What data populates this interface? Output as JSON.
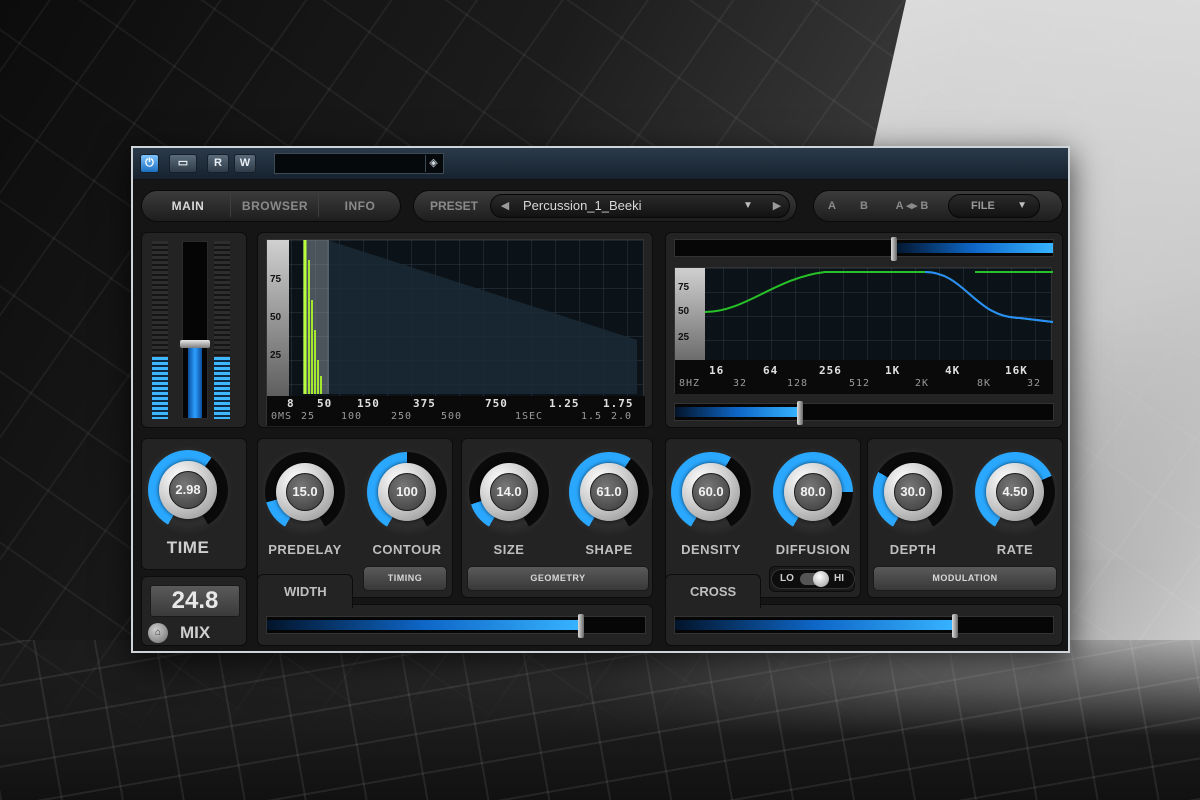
{
  "titlebar": {
    "power_label": "⏻",
    "rect_label": "▭",
    "r_label": "R",
    "w_label": "W",
    "field_value": "",
    "field_icon": "◈"
  },
  "nav": {
    "tabs": [
      "MAIN",
      "BROWSER",
      "INFO"
    ],
    "active": "MAIN"
  },
  "preset": {
    "label": "PRESET",
    "prev": "◀",
    "next": "▶",
    "name": "Percussion_1_Beeki",
    "dropdown": "▼"
  },
  "ab": {
    "a": "A",
    "b": "B",
    "copy": "A ◂▸ B",
    "file": "FILE",
    "file_dropdown": "▼"
  },
  "meters": {
    "left_level": 0.35,
    "right_level": 0.35,
    "fader_level": 0.4
  },
  "decay_graph": {
    "scale_labels": [
      "75",
      "50",
      "25"
    ],
    "top_axis": [
      "8",
      "50",
      "150",
      "375",
      "750",
      "1.25",
      "1.75"
    ],
    "bottom_axis": [
      "0MS",
      "25",
      "100",
      "250",
      "500",
      "1SEC",
      "1.5",
      "2.0"
    ]
  },
  "eq_graph": {
    "scale_labels": [
      "75",
      "50",
      "25"
    ],
    "top_axis": [
      "16",
      "64",
      "256",
      "1K",
      "4K",
      "16K"
    ],
    "bottom_axis": [
      "8HZ",
      "32",
      "128",
      "512",
      "2K",
      "8K",
      "32"
    ],
    "top_slider_level": 0.58,
    "bottom_slider_level": 0.33
  },
  "knobs": [
    {
      "id": "time",
      "label": "TIME",
      "value": "2.98",
      "level": 0.62
    },
    {
      "id": "predelay",
      "label": "PREDELAY",
      "value": "15.0",
      "level": 0.15
    },
    {
      "id": "contour",
      "label": "CONTOUR",
      "value": "100",
      "level": 0.5
    },
    {
      "id": "size",
      "label": "SIZE",
      "value": "14.0",
      "level": 0.14
    },
    {
      "id": "shape",
      "label": "SHAPE",
      "value": "61.0",
      "level": 0.61
    },
    {
      "id": "density",
      "label": "DENSITY",
      "value": "60.0",
      "level": 0.6
    },
    {
      "id": "diffusion",
      "label": "DIFFUSION",
      "value": "80.0",
      "level": 0.8
    },
    {
      "id": "depth",
      "label": "DEPTH",
      "value": "30.0",
      "level": 0.3
    },
    {
      "id": "rate",
      "label": "RATE",
      "value": "4.50",
      "level": 0.72
    }
  ],
  "groups": {
    "timing": "TIMING",
    "geometry": "GEOMETRY",
    "modulation": "MODULATION"
  },
  "mix": {
    "value": "24.8",
    "label": "MIX"
  },
  "width": {
    "label": "WIDTH",
    "level": 0.83
  },
  "cross": {
    "label": "CROSS",
    "level": 0.74
  },
  "hilo": {
    "lo": "LO",
    "hi": "HI"
  },
  "colors": {
    "accent": "#2aa8ff",
    "panel": "#232323",
    "curve": "#27c227"
  }
}
